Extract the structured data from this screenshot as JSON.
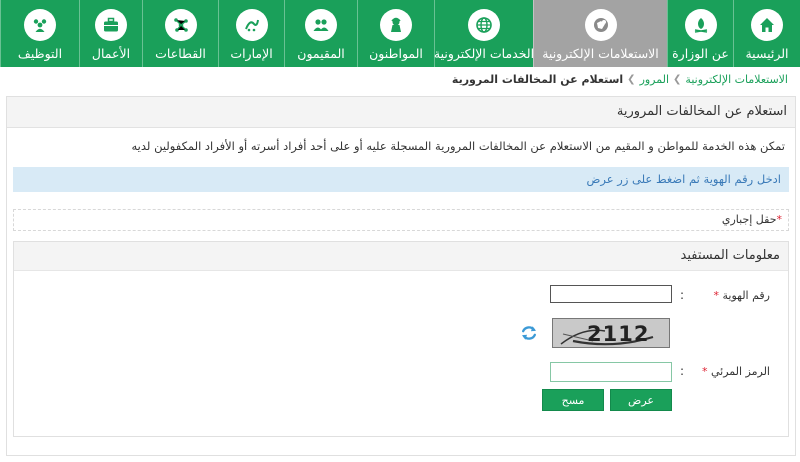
{
  "nav": {
    "items": [
      {
        "label": "الرئيسية",
        "icon": "home-icon"
      },
      {
        "label": "عن الوزارة",
        "icon": "ministry-emblem-icon"
      },
      {
        "label": "الاستعلامات الإلكترونية",
        "icon": "inquiry-icon"
      },
      {
        "label": "الخدمات الإلكترونية",
        "icon": "globe-icon"
      },
      {
        "label": "المواطنون",
        "icon": "citizen-icon"
      },
      {
        "label": "المقيمون",
        "icon": "residents-icon"
      },
      {
        "label": "الإمارات",
        "icon": "emirates-icon"
      },
      {
        "label": "القطاعات",
        "icon": "sectors-icon"
      },
      {
        "label": "الأعمال",
        "icon": "briefcase-icon"
      },
      {
        "label": "التوظيف",
        "icon": "employment-icon"
      }
    ],
    "active_index": 2,
    "accent": "#1aa05a",
    "active_bg": "#a3a3a3"
  },
  "breadcrumb": {
    "items": [
      "الاستعلامات الإلكترونية",
      "المرور",
      "استعلام عن المخالفات المرورية"
    ]
  },
  "page": {
    "title": "استعلام عن المخالفات المرورية",
    "description": "تمكن هذه الخدمة للمواطن و المقيم من الاستعلام عن المخالفات المرورية المسجلة عليه أو على أحد أفراد أسرته أو الأفراد المكفولين لديه",
    "info": "ادخل رقم الهوية ثم اضغط على زر عرض",
    "required_note": "حقل إجباري"
  },
  "form": {
    "section_title": "معلومات المستفيد",
    "id_label": "رقم الهوية",
    "id_value": "",
    "captcha_text": "2112",
    "code_label": "الرمز المرئي",
    "code_value": "",
    "colon": ":",
    "submit_label": "عرض",
    "clear_label": "مسح"
  }
}
